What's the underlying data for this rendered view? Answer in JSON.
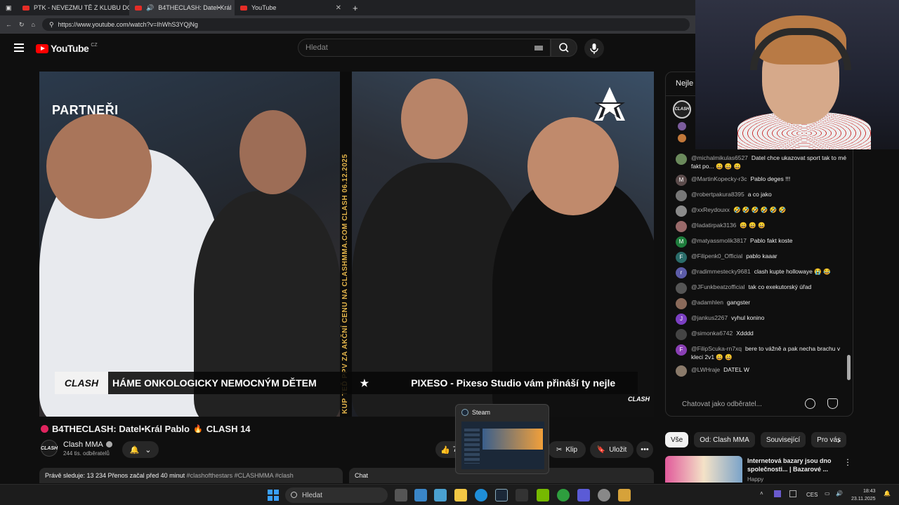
{
  "browser": {
    "tabs": [
      {
        "title": "PTK - NEVEZMU TĚ Z KLUBU DO...",
        "active": false
      },
      {
        "title": "B4THECLASH: Datel•Král",
        "active": true
      },
      {
        "title": "YouTube",
        "active": false
      }
    ],
    "new_tab": "+",
    "url": "https://www.youtube.com/watch?v=IhWhS3YQjNg"
  },
  "youtube": {
    "logo_text": "YouTube",
    "region": "CZ",
    "search_placeholder": "Hledat"
  },
  "video": {
    "partneri": "PARTNEŘI",
    "vertical_text": "KUP TEĎ PPV ZA AKČNÍ CENU NA CLASHMMA.COM  CLASH  06.12.2025",
    "clash_box": "CLASH",
    "ticker_1": "HÁME ONKOLOGICKY NEMOCNÝM DĚTEM",
    "ticker_star": "★",
    "ticker_2": "PIXESO - Pixeso Studio vám přináší ty nejle",
    "corner_logo": "CLASH"
  },
  "meta": {
    "title": "B4THECLASH: Datel•Král Pablo 🔥 CLASH 14",
    "title_parts": {
      "left": "B4THECLASH: Datel•Král Pablo",
      "right": "CLASH 14"
    },
    "fire": "🔥",
    "channel": "Clash MMA",
    "channel_avatar": "CLASH",
    "subscribers": "244 tis. odběratelů",
    "like_count": "7",
    "clip_label": "Klip",
    "save_label": "Uložit",
    "more": "•••",
    "info_text": "Právě sleduje: 13 234  Přenos začal před 40 minut ",
    "info_tags": "#clashofthestars #CLASHMMA #clash",
    "chat_label": "Chat"
  },
  "steam_popup": {
    "title": "Steam"
  },
  "chat": {
    "header": "Nejle",
    "pinned_avatar": "CLASH",
    "input_placeholder": "Chatovat jako odběratel...",
    "messages": [
      {
        "author": "@michalmikulas6527",
        "text": "Datel chce ukazovat sport tak to mé fakt po... 😀 😀 😀",
        "color": "#6b8a5c",
        "initial": ""
      },
      {
        "author": "@MartinKopecky-r3c",
        "text": "Pablo deges !!!",
        "color": "#5b4b4b",
        "initial": "M"
      },
      {
        "author": "@robertpakura8395",
        "text": "a co jako",
        "color": "#777777",
        "initial": ""
      },
      {
        "author": "@xxReydouxx",
        "text": "🤣 🤣 🤣 🤣 🤣 🤣",
        "color": "#8a8a8a",
        "initial": ""
      },
      {
        "author": "@ladatirpak3136",
        "text": "😀 😀 😀",
        "color": "#9a6a6a",
        "initial": ""
      },
      {
        "author": "@matyassmolik3817",
        "text": "Pablo fakt koste",
        "color": "#1e7d3c",
        "initial": "M"
      },
      {
        "author": "@Filipenk0_Official",
        "text": "pablo kaaar",
        "color": "#2a6c6a",
        "initial": "F"
      },
      {
        "author": "@radimmestecky9681",
        "text": "clash kupte hollowaye 😭 😂",
        "color": "#5c5ca8",
        "initial": "r"
      },
      {
        "author": "@JFunkbeatzofficial",
        "text": "tak co exekutorský úřad",
        "color": "#555555",
        "initial": ""
      },
      {
        "author": "@adamhlen",
        "text": "gangster",
        "color": "#8a6a5a",
        "initial": ""
      },
      {
        "author": "@jankus2267",
        "text": "vyhul konino",
        "color": "#7b3fc2",
        "initial": "J"
      },
      {
        "author": "@simonka6742",
        "text": "Xdddd",
        "color": "#444444",
        "initial": ""
      },
      {
        "author": "@FilipScuka-rn7xq",
        "text": "bere to vážně a pak necha brachu v kleci 2v1 😀 😀",
        "color": "#8a3fb5",
        "initial": "F"
      },
      {
        "author": "@LWHraje",
        "text": "DATEL W",
        "color": "#8a7a6a",
        "initial": ""
      }
    ]
  },
  "chips": [
    "Vše",
    "Od: Clash MMA",
    "Související",
    "Pro vás"
  ],
  "chips_next": "›",
  "recommendation": {
    "title": "Internetová bazary jsou dno společnosti... | Bazarové ...",
    "channel": "Happy"
  },
  "taskbar": {
    "search_placeholder": "Hledat",
    "language": "CES",
    "time": "18:43",
    "date": "23.11.2025"
  },
  "colors": {
    "accent_red": "#ff0000",
    "ticker_gold": "#e2b34a",
    "windows_blue": "#3aa0ff"
  }
}
